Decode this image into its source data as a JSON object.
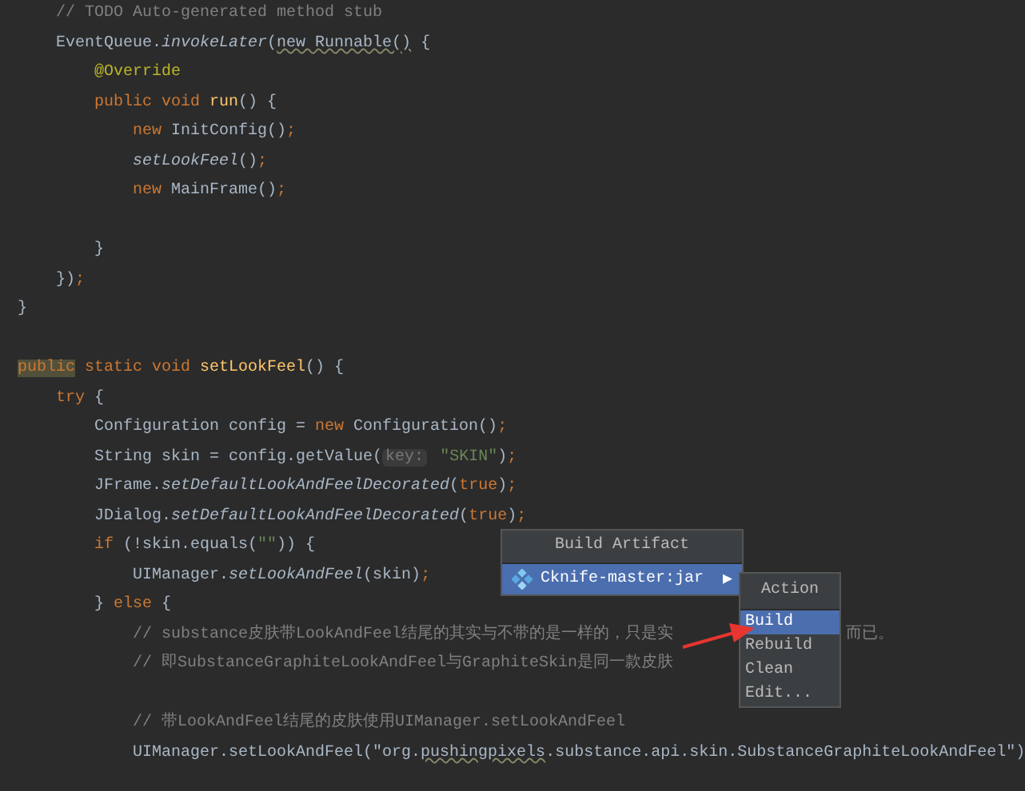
{
  "editor": {
    "blocks": [
      {
        "lines": [
          {
            "tokens": [
              {
                "kind": "cm",
                "t": "    // TODO Auto-generated method stub"
              }
            ]
          },
          {
            "tokens": [
              {
                "kind": "p",
                "t": "    EventQueue."
              },
              {
                "kind": "it",
                "t": "invokeLater"
              },
              {
                "kind": "p",
                "t": "("
              },
              {
                "kind": "warn",
                "t": "new Runnable()"
              },
              {
                "kind": "p",
                "t": " {"
              }
            ]
          },
          {
            "tokens": [
              {
                "kind": "ann",
                "t": "        @Override"
              }
            ]
          },
          {
            "tokens": [
              {
                "kind": "kw",
                "t": "        public void "
              },
              {
                "kind": "fn",
                "t": "run"
              },
              {
                "kind": "p",
                "t": "() {"
              }
            ]
          },
          {
            "tokens": [
              {
                "kind": "kw",
                "t": "            new "
              },
              {
                "kind": "p",
                "t": "InitConfig()"
              },
              {
                "kind": "kw",
                "t": ";"
              }
            ]
          },
          {
            "tokens": [
              {
                "kind": "it",
                "t": "            setLookFeel"
              },
              {
                "kind": "p",
                "t": "()"
              },
              {
                "kind": "kw",
                "t": ";"
              }
            ]
          },
          {
            "tokens": [
              {
                "kind": "kw",
                "t": "            new "
              },
              {
                "kind": "p",
                "t": "MainFrame()"
              },
              {
                "kind": "kw",
                "t": ";"
              }
            ]
          }
        ]
      },
      {
        "lines": [
          {
            "tokens": [
              {
                "kind": "p",
                "t": "        }"
              }
            ]
          },
          {
            "tokens": [
              {
                "kind": "p",
                "t": "    })"
              },
              {
                "kind": "kw",
                "t": ";"
              }
            ]
          },
          {
            "tokens": [
              {
                "kind": "p",
                "t": "}"
              }
            ]
          }
        ]
      },
      {
        "lines": [
          {
            "tokens": [
              {
                "kind": "hl",
                "t": "public"
              },
              {
                "kind": "kw",
                "t": " static void "
              },
              {
                "kind": "fn",
                "t": "setLookFeel"
              },
              {
                "kind": "p",
                "t": "() {"
              }
            ]
          },
          {
            "tokens": [
              {
                "kind": "kw",
                "t": "    try "
              },
              {
                "kind": "p",
                "t": "{"
              }
            ]
          },
          {
            "tokens": [
              {
                "kind": "p",
                "t": "        Configuration config = "
              },
              {
                "kind": "kw",
                "t": "new "
              },
              {
                "kind": "p",
                "t": "Configuration()"
              },
              {
                "kind": "kw",
                "t": ";"
              }
            ]
          },
          {
            "tokens": [
              {
                "kind": "p",
                "t": "        String skin = config.getValue("
              },
              {
                "kind": "hint",
                "t": "key:"
              },
              {
                "kind": "str",
                "t": " \"SKIN\""
              },
              {
                "kind": "p",
                "t": ")"
              },
              {
                "kind": "kw",
                "t": ";"
              }
            ]
          },
          {
            "tokens": [
              {
                "kind": "p",
                "t": "        JFrame."
              },
              {
                "kind": "it",
                "t": "setDefaultLookAndFeelDecorated"
              },
              {
                "kind": "p",
                "t": "("
              },
              {
                "kind": "kw",
                "t": "true"
              },
              {
                "kind": "p",
                "t": ")"
              },
              {
                "kind": "kw",
                "t": ";"
              }
            ]
          },
          {
            "tokens": [
              {
                "kind": "p",
                "t": "        JDialog."
              },
              {
                "kind": "it",
                "t": "setDefaultLookAndFeelDecorated"
              },
              {
                "kind": "p",
                "t": "("
              },
              {
                "kind": "kw",
                "t": "true"
              },
              {
                "kind": "p",
                "t": ")"
              },
              {
                "kind": "kw",
                "t": ";"
              }
            ]
          },
          {
            "tokens": [
              {
                "kind": "kw",
                "t": "        if "
              },
              {
                "kind": "p",
                "t": "(!skin.equals("
              },
              {
                "kind": "str",
                "t": "\"\""
              },
              {
                "kind": "p",
                "t": ")) {"
              }
            ]
          },
          {
            "tokens": [
              {
                "kind": "p",
                "t": "            UIManager."
              },
              {
                "kind": "it",
                "t": "setLookAndFeel"
              },
              {
                "kind": "p",
                "t": "(skin)"
              },
              {
                "kind": "kw",
                "t": ";"
              }
            ]
          },
          {
            "tokens": [
              {
                "kind": "p",
                "t": "        } "
              },
              {
                "kind": "kw",
                "t": "else "
              },
              {
                "kind": "p",
                "t": "{"
              }
            ]
          },
          {
            "tokens": [
              {
                "kind": "cm",
                "t": "            // substance皮肤带LookAndFeel结尾的其实与不带的是一样的，只是实"
              }
            ],
            "tail": "而已。"
          },
          {
            "tokens": [
              {
                "kind": "cm",
                "t": "            // 即SubstanceGraphiteLookAndFeel与GraphiteSkin是同一款皮肤"
              }
            ]
          }
        ]
      },
      {
        "lines": [
          {
            "tokens": [
              {
                "kind": "cm",
                "t": "            // 带LookAndFeel结尾的皮肤使用UIManager.setLookAndFeel"
              }
            ]
          },
          {
            "tokens": [
              {
                "kind": "p",
                "t": "            UIManager.setLookAndFeel(\"org."
              },
              {
                "kind": "warn",
                "t": "pushingpixels"
              },
              {
                "kind": "p",
                "t": ".substance.api.skin.SubstanceGraphiteLookAndFeel\")"
              }
            ]
          }
        ]
      }
    ]
  },
  "popup_menu": {
    "title": "Build Artifact",
    "items": [
      {
        "label": "Cknife-master:jar",
        "arrow": "▶",
        "selected": true
      }
    ]
  },
  "submenu": {
    "title": "Action",
    "items": [
      {
        "label": "Build",
        "selected": true
      },
      {
        "label": "Rebuild",
        "selected": false
      },
      {
        "label": "Clean",
        "selected": false
      },
      {
        "label": "Edit...",
        "selected": false
      }
    ]
  }
}
